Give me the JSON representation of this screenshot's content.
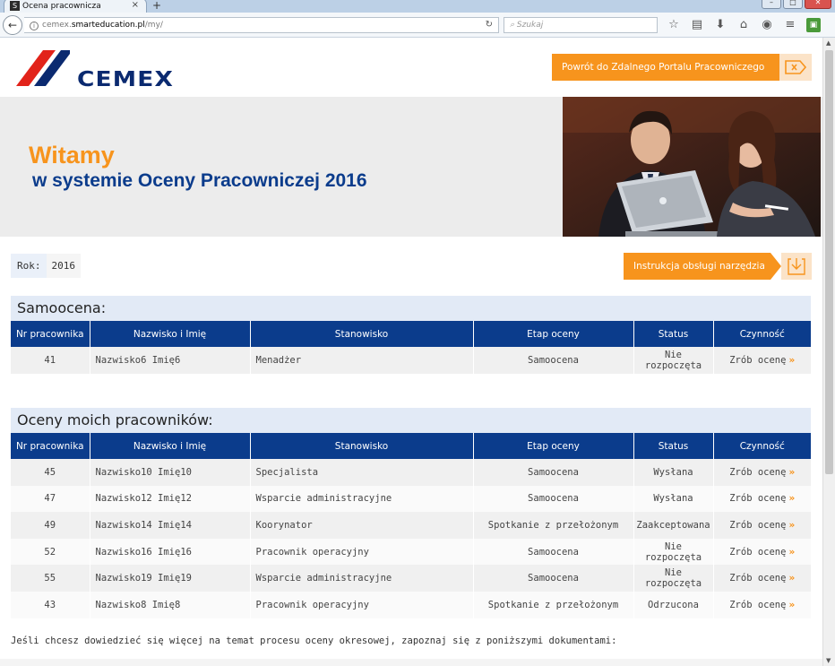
{
  "browser": {
    "tab_title": "Ocena pracownicza",
    "favicon_letter": "S",
    "tab_close": "×",
    "new_tab": "+",
    "url_prefix": "cemex.",
    "url_domain": "smarteducation.pl",
    "url_path": "/my/",
    "search_placeholder": "Szukaj"
  },
  "header": {
    "logo_text": "CEMEX",
    "portal_button": "Powrót do Zdalnego Portalu Pracowniczego"
  },
  "hero": {
    "title": "Witamy",
    "subtitle": "w systemie Oceny Pracowniczej 2016"
  },
  "year": {
    "label": "Rok:",
    "value": "2016"
  },
  "instructions_button": "Instrukcja obsługi narzędzia",
  "columns": [
    "Nr pracownika",
    "Nazwisko i Imię",
    "Stanowisko",
    "Etap oceny",
    "Status",
    "Czynność"
  ],
  "self_assessment": {
    "title": "Samoocena:",
    "rows": [
      {
        "nr": "41",
        "name": "Nazwisko6 Imię6",
        "position": "Menadżer",
        "stage": "Samoocena",
        "status": "Nie rozpoczęta",
        "status_color": "red",
        "action": "Zrób ocenę"
      }
    ]
  },
  "employees": {
    "title": "Oceny moich pracowników:",
    "rows": [
      {
        "nr": "45",
        "name": "Nazwisko10 Imię10",
        "position": "Specjalista",
        "stage": "Samoocena",
        "status": "Wysłana",
        "status_color": "green",
        "action": "Zrób ocenę"
      },
      {
        "nr": "47",
        "name": "Nazwisko12 Imię12",
        "position": "Wsparcie administracyjne",
        "stage": "Samoocena",
        "status": "Wysłana",
        "status_color": "green",
        "action": "Zrób ocenę"
      },
      {
        "nr": "49",
        "name": "Nazwisko14 Imię14",
        "position": "Koorynator",
        "stage": "Spotkanie z przełożonym",
        "status": "Zaakceptowana",
        "status_color": "green",
        "action": "Zrób ocenę"
      },
      {
        "nr": "52",
        "name": "Nazwisko16 Imię16",
        "position": "Pracownik operacyjny",
        "stage": "Samoocena",
        "status": "Nie rozpoczęta",
        "status_color": "red",
        "action": "Zrób ocenę"
      },
      {
        "nr": "55",
        "name": "Nazwisko19 Imię19",
        "position": "Wsparcie administracyjne",
        "stage": "Samoocena",
        "status": "Nie rozpoczęta",
        "status_color": "red",
        "action": "Zrób ocenę"
      },
      {
        "nr": "43",
        "name": "Nazwisko8 Imię8",
        "position": "Pracownik operacyjny",
        "stage": "Spotkanie z przełożonym",
        "status": "Odrzucona",
        "status_color": "red",
        "action": "Zrób ocenę"
      }
    ]
  },
  "footer_text": "Jeśli chcesz dowiedzieć się więcej na temat procesu oceny okresowej, zapoznaj się z poniższymi dokumentami:",
  "colors": {
    "accent": "#f7941d",
    "brand_blue": "#0b3c8c",
    "status_red": "#e03a2b",
    "status_green": "#3a9a3a"
  }
}
